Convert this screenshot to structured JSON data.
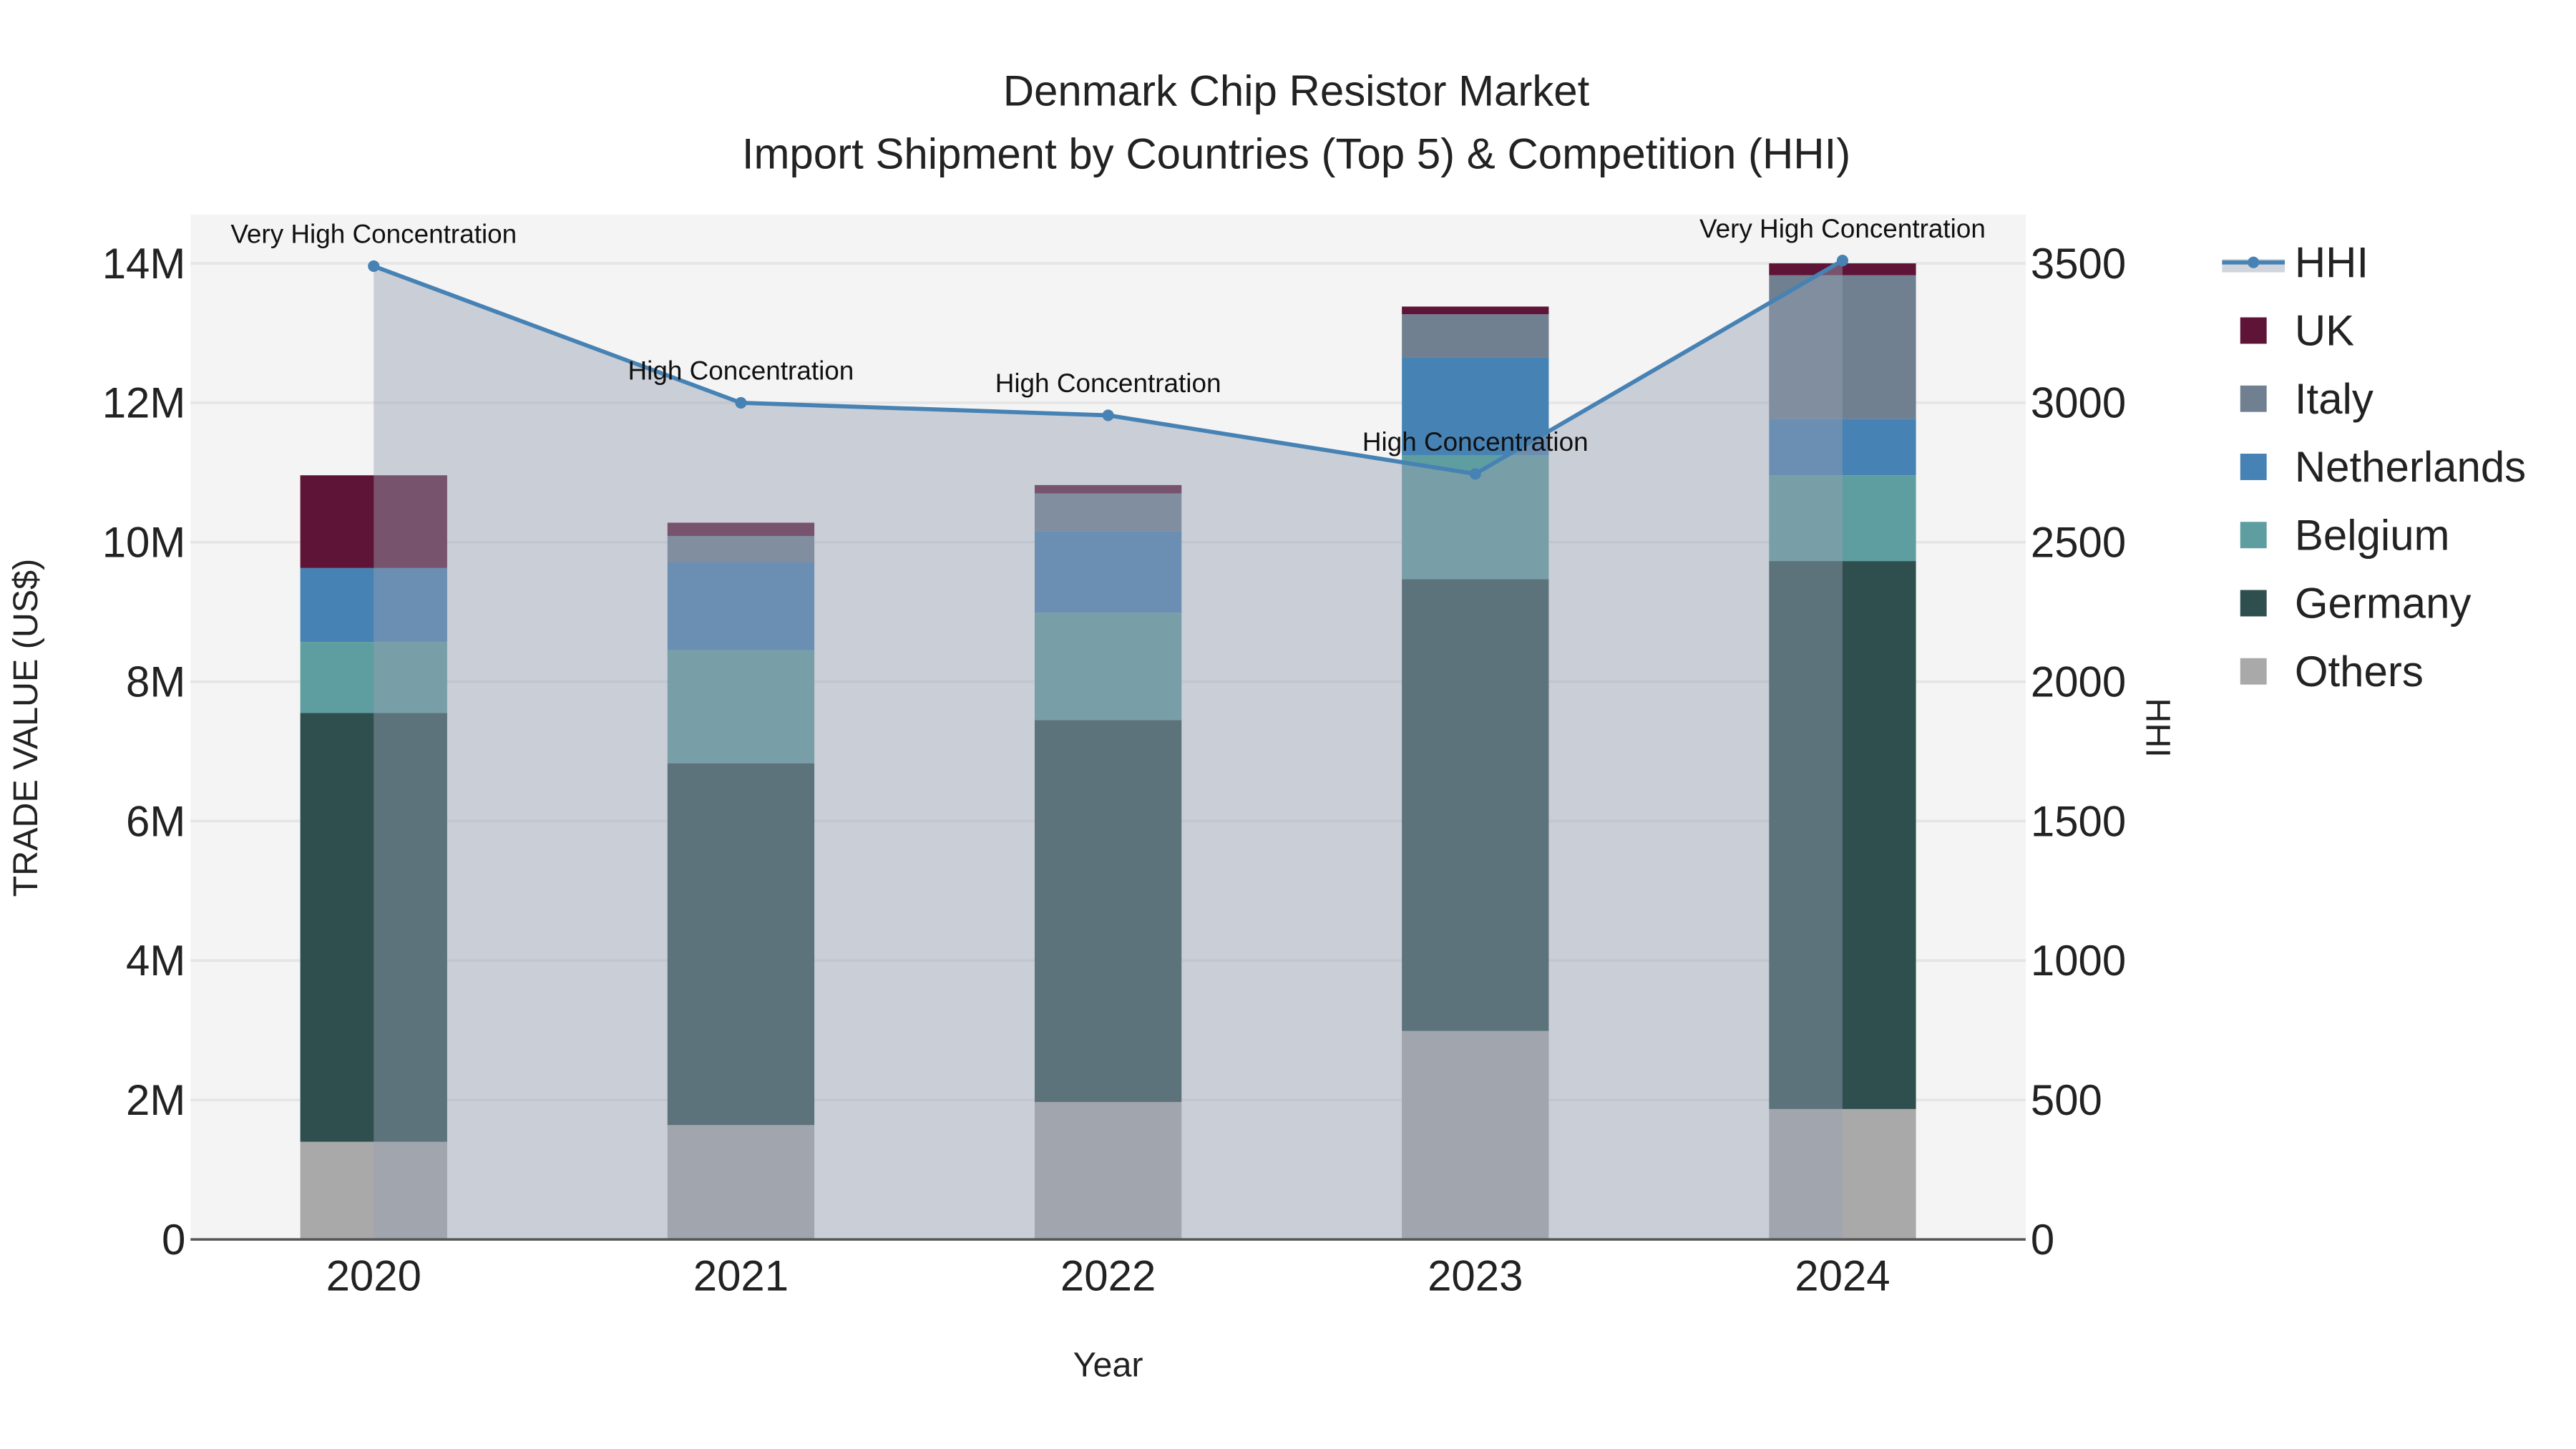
{
  "chart_data": {
    "type": "bar",
    "title": "Denmark Chip Resistor Market",
    "subtitle": "Import Shipment by Countries (Top 5) & Competition (HHI)",
    "xlabel": "Year",
    "ylabel": "TRADE VALUE (US$)",
    "y2label": "HHI",
    "categories": [
      "2020",
      "2021",
      "2022",
      "2023",
      "2024"
    ],
    "ylim": [
      0,
      14700000
    ],
    "y2lim": [
      0,
      3675
    ],
    "yticks": [
      0,
      2000000,
      4000000,
      6000000,
      8000000,
      10000000,
      12000000,
      14000000
    ],
    "ytick_labels": [
      "0",
      "2M",
      "4M",
      "6M",
      "8M",
      "10M",
      "12M",
      "14M"
    ],
    "y2ticks": [
      0,
      500,
      1000,
      1500,
      2000,
      2500,
      3000,
      3500
    ],
    "y2tick_labels": [
      "0",
      "500",
      "1000",
      "1500",
      "2000",
      "2500",
      "3000",
      "3500"
    ],
    "grid": true,
    "legend_placement": "right",
    "series": [
      {
        "name": "Others",
        "color": "#a9a9a9",
        "values": [
          1400000,
          1640000,
          1970000,
          2990000,
          1870000
        ]
      },
      {
        "name": "Germany",
        "color": "#2f4f4f",
        "values": [
          6150000,
          5190000,
          5480000,
          6480000,
          7860000
        ]
      },
      {
        "name": "Belgium",
        "color": "#5f9ea0",
        "values": [
          1020000,
          1620000,
          1540000,
          1780000,
          1230000
        ]
      },
      {
        "name": "Netherlands",
        "color": "#4682b4",
        "values": [
          1060000,
          1260000,
          1170000,
          1400000,
          810000
        ]
      },
      {
        "name": "Italy",
        "color": "#708090",
        "values": [
          0,
          380000,
          540000,
          620000,
          2060000
        ]
      },
      {
        "name": "UK",
        "color": "#5e1436",
        "values": [
          1330000,
          190000,
          120000,
          110000,
          170000
        ]
      }
    ],
    "hhi": {
      "name": "HHI",
      "color": "#4682b4",
      "values": [
        3490,
        3000,
        2955,
        2745,
        3510
      ],
      "annotations": [
        "Very High Concentration",
        "High Concentration",
        "High Concentration",
        "High Concentration",
        "Very High Concentration"
      ]
    },
    "legend": [
      "HHI",
      "UK",
      "Italy",
      "Netherlands",
      "Belgium",
      "Germany",
      "Others"
    ]
  }
}
